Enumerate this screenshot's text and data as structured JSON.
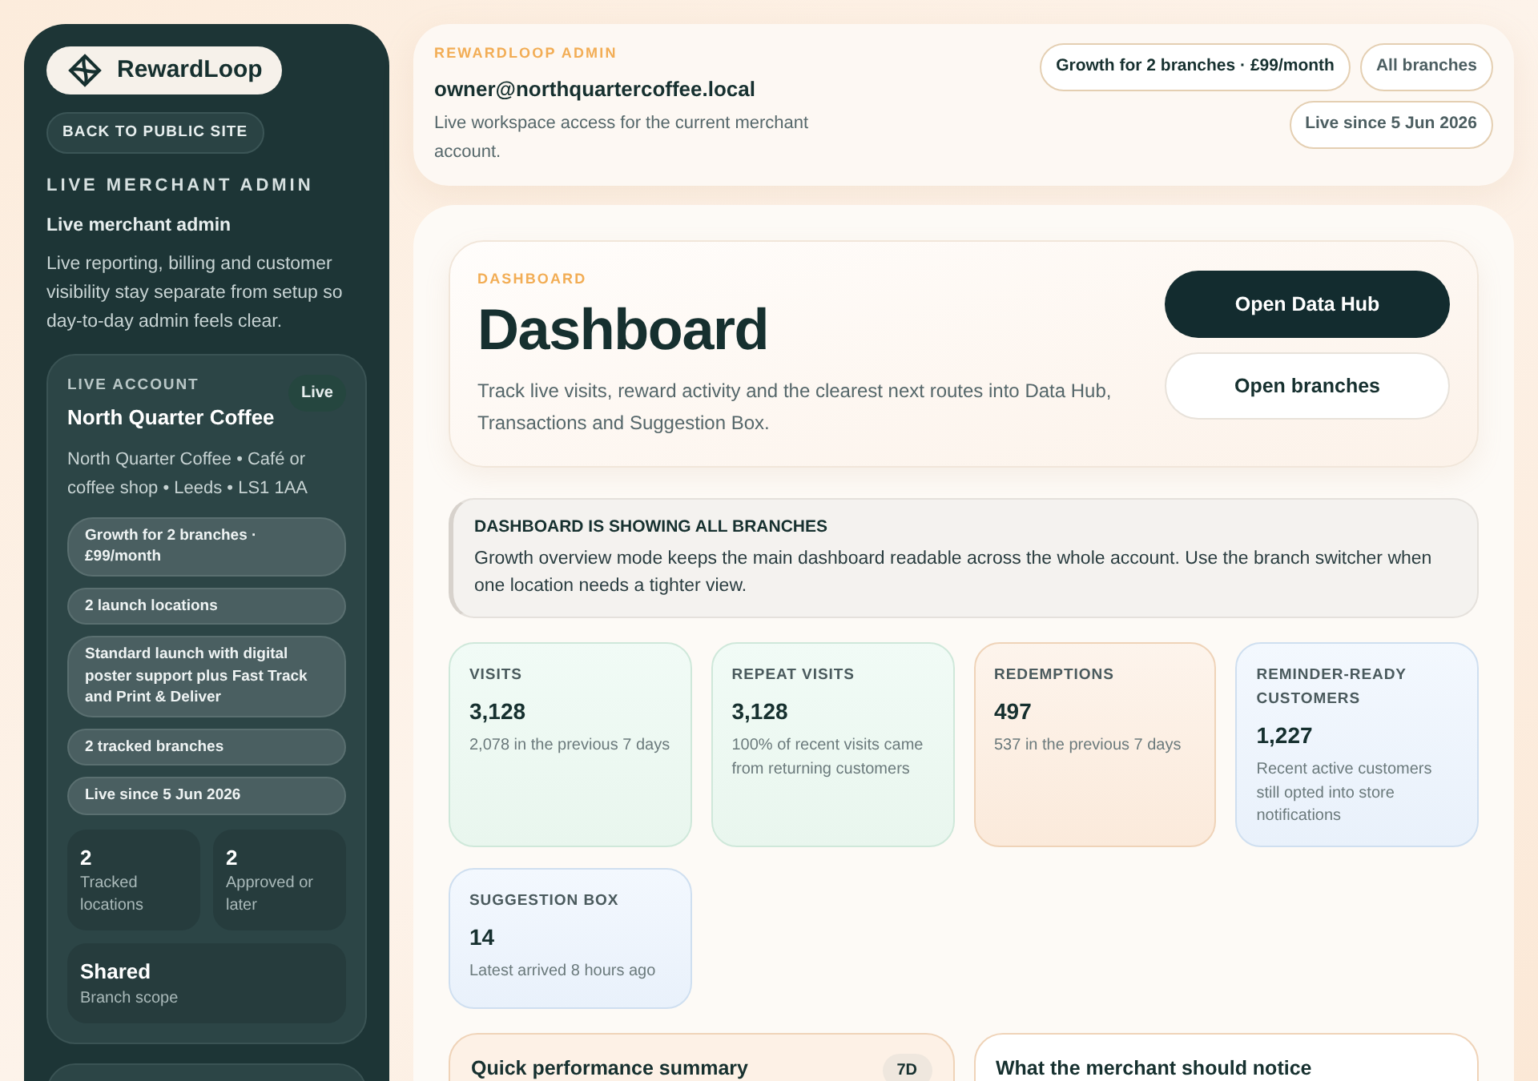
{
  "sidebar": {
    "brand": "RewardLoop",
    "back_link": "BACK TO PUBLIC SITE",
    "section_label": "LIVE MERCHANT ADMIN",
    "heading": "Live merchant admin",
    "description": "Live reporting, billing and customer visibility stay separate from setup so day-to-day admin feels clear.",
    "account": {
      "label": "LIVE ACCOUNT",
      "status": "Live",
      "name": "North Quarter Coffee",
      "details": "North Quarter Coffee • Café or coffee shop • Leeds • LS1 1AA",
      "chips": [
        "Growth for 2 branches · £99/month",
        "2 launch locations",
        "Standard launch with digital poster support plus Fast Track and Print & Deliver",
        "2 tracked branches",
        "Live since 5 Jun 2026"
      ],
      "stats": [
        {
          "value": "2",
          "label": "Tracked locations"
        },
        {
          "value": "2",
          "label": "Approved or later"
        },
        {
          "value": "Shared",
          "label": "Branch scope"
        }
      ]
    }
  },
  "header": {
    "eyebrow": "REWARDLOOP ADMIN",
    "email": "owner@northquartercoffee.local",
    "description": "Live workspace access for the current merchant account.",
    "pills": [
      {
        "label": "Growth for 2 branches · £99/month",
        "kind": "strong"
      },
      {
        "label": "All branches",
        "kind": "muted"
      },
      {
        "label": "Live since 5 Jun 2026",
        "kind": "muted"
      }
    ]
  },
  "hero": {
    "eyebrow": "DASHBOARD",
    "title": "Dashboard",
    "description": "Track live visits, reward activity and the clearest next routes into Data Hub, Transactions and Suggestion Box.",
    "buttons": [
      {
        "label": "Open Data Hub",
        "kind": "primary"
      },
      {
        "label": "Open branches",
        "kind": "secondary"
      }
    ]
  },
  "notice": {
    "title": "DASHBOARD IS SHOWING ALL BRANCHES",
    "text": "Growth overview mode keeps the main dashboard readable across the whole account. Use the branch switcher when one location needs a tighter view."
  },
  "metrics": [
    {
      "label": "VISITS",
      "value": "3,128",
      "note": "2,078 in the previous 7 days",
      "kind": "green"
    },
    {
      "label": "REPEAT VISITS",
      "value": "3,128",
      "note": "100% of recent visits came from returning customers",
      "kind": "green"
    },
    {
      "label": "REDEMPTIONS",
      "value": "497",
      "note": "537 in the previous 7 days",
      "kind": "peach"
    },
    {
      "label": "REMINDER-READY CUSTOMERS",
      "value": "1,227",
      "note": "Recent active customers still opted into store notifications",
      "kind": "blue"
    },
    {
      "label": "SUGGESTION BOX",
      "value": "14",
      "note": "Latest arrived 8 hours ago",
      "kind": "blue"
    }
  ],
  "panels": [
    {
      "title": "Quick performance summary",
      "badge": "7D",
      "kind": "peach"
    },
    {
      "title": "What the merchant should notice",
      "kind": "white"
    }
  ]
}
